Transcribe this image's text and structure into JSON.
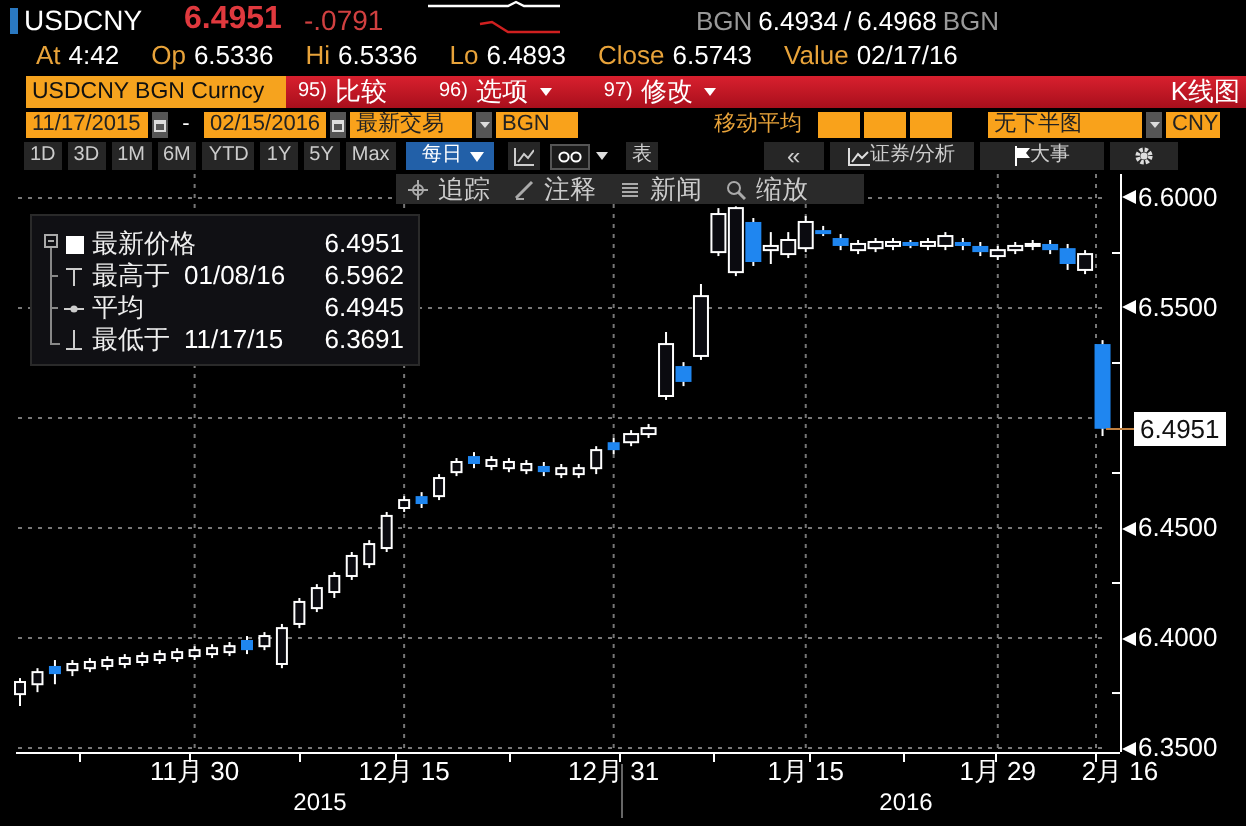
{
  "quote": {
    "ticker": "USDCNY",
    "last": "6.4951",
    "change": "-.0791",
    "bid_source": "BGN",
    "bid": "6.4934",
    "separator": "/",
    "ask": "6.4968",
    "ask_source": "BGN"
  },
  "stats": [
    {
      "label": "At",
      "value": "4:42"
    },
    {
      "label": "Op",
      "value": "6.5336"
    },
    {
      "label": "Hi",
      "value": "6.5336"
    },
    {
      "label": "Lo",
      "value": "6.4893"
    },
    {
      "label": "Close",
      "value": "6.5743"
    },
    {
      "label": "Value",
      "value": "02/17/16"
    }
  ],
  "function_bar": {
    "security": "USDCNY BGN Curncy",
    "menus": [
      {
        "number": "95)",
        "label": "比较",
        "dropdown": false
      },
      {
        "number": "96)",
        "label": "选项",
        "dropdown": true
      },
      {
        "number": "97)",
        "label": "修改",
        "dropdown": true
      }
    ],
    "chart_type": "K线图"
  },
  "settings_bar": {
    "start_date": "11/17/2015",
    "separator": "-",
    "end_date": "02/15/2016",
    "price_type": "最新交易",
    "source": "BGN",
    "moving_average_label": "移动平均",
    "lower_chart": "无下半图",
    "currency": "CNY"
  },
  "period_bar": {
    "ranges": [
      "1D",
      "3D",
      "1M",
      "6M",
      "YTD",
      "1Y",
      "5Y",
      "Max"
    ],
    "frequency": "每日",
    "table": "表",
    "back": "«",
    "analysis": "证券/分析",
    "events": "大事"
  },
  "chart_toolbar": [
    {
      "kind": "crosshair",
      "label": "追踪"
    },
    {
      "kind": "pen",
      "label": "注释"
    },
    {
      "kind": "news",
      "label": "新闻"
    },
    {
      "kind": "zoom",
      "label": "缩放"
    }
  ],
  "legend": [
    {
      "kind": "last",
      "label": "最新价格",
      "value": "6.4951"
    },
    {
      "kind": "high",
      "label": "最高于",
      "date": "01/08/16",
      "value": "6.5962"
    },
    {
      "kind": "average",
      "label": "平均",
      "value": "6.4945"
    },
    {
      "kind": "low",
      "label": "最低于",
      "date": "11/17/15",
      "value": "6.3691"
    }
  ],
  "chart": {
    "chart_data": {
      "type": "candlestick",
      "grid": true,
      "ylim": [
        6.3482,
        6.6109
      ],
      "categories": [
        null,
        null,
        null,
        null,
        null,
        null,
        null,
        null,
        null,
        null,
        "11月 30",
        null,
        null,
        null,
        null,
        null,
        null,
        null,
        null,
        null,
        null,
        null,
        "12月 15",
        null,
        null,
        null,
        null,
        null,
        null,
        null,
        null,
        null,
        null,
        null,
        "12月 31",
        null,
        null,
        null,
        null,
        null,
        null,
        null,
        null,
        null,
        null,
        "1月 15",
        null,
        null,
        null,
        null,
        null,
        null,
        null,
        null,
        null,
        null,
        "1月 29",
        null,
        null,
        null,
        null,
        null,
        null,
        "2月 16"
      ],
      "ohlc": [
        [
          6.3745,
          6.3818,
          6.3691,
          6.38
        ],
        [
          6.379,
          6.3863,
          6.3754,
          6.3845
        ],
        [
          6.3873,
          6.39,
          6.379,
          6.3836
        ],
        [
          6.3854,
          6.39,
          6.3827,
          6.3882
        ],
        [
          6.3863,
          6.3909,
          6.3845,
          6.3891
        ],
        [
          6.3873,
          6.3918,
          6.3854,
          6.39
        ],
        [
          6.3882,
          6.3927,
          6.3863,
          6.3909
        ],
        [
          6.3891,
          6.3936,
          6.3873,
          6.3918
        ],
        [
          6.39,
          6.3945,
          6.3882,
          6.3927
        ],
        [
          6.3909,
          6.3954,
          6.3891,
          6.3936
        ],
        [
          6.3918,
          6.3963,
          6.39,
          6.3945
        ],
        [
          6.3927,
          6.3972,
          6.3909,
          6.3954
        ],
        [
          6.3936,
          6.3982,
          6.3918,
          6.3963
        ],
        [
          6.3991,
          6.4009,
          6.3927,
          6.3945
        ],
        [
          6.3963,
          6.4027,
          6.3945,
          6.4009
        ],
        [
          6.3882,
          6.4064,
          6.3863,
          6.4045
        ],
        [
          6.4064,
          6.4182,
          6.4045,
          6.4164
        ],
        [
          6.4136,
          6.4245,
          6.4118,
          6.4227
        ],
        [
          6.4209,
          6.43,
          6.4182,
          6.4282
        ],
        [
          6.4282,
          6.4391,
          6.4264,
          6.4373
        ],
        [
          6.4336,
          6.4445,
          6.4318,
          6.4427
        ],
        [
          6.4409,
          6.4573,
          6.4391,
          6.4555
        ],
        [
          6.4591,
          6.4645,
          6.4573,
          6.4627
        ],
        [
          6.4645,
          6.4663,
          6.4591,
          6.4609
        ],
        [
          6.4645,
          6.4745,
          6.4627,
          6.4727
        ],
        [
          6.4754,
          6.4818,
          6.4736,
          6.48
        ],
        [
          6.4827,
          6.4845,
          6.4772,
          6.4791
        ],
        [
          6.4782,
          6.4827,
          6.4763,
          6.4809
        ],
        [
          6.4772,
          6.4818,
          6.4754,
          6.48
        ],
        [
          6.4763,
          6.4809,
          6.4745,
          6.4791
        ],
        [
          6.4782,
          6.48,
          6.4736,
          6.4754
        ],
        [
          6.4745,
          6.4791,
          6.4727,
          6.4772
        ],
        [
          6.4745,
          6.4791,
          6.4727,
          6.4772
        ],
        [
          6.4772,
          6.4872,
          6.4745,
          6.4854
        ],
        [
          6.489,
          6.4909,
          6.4836,
          6.4854
        ],
        [
          6.489,
          6.4945,
          6.4872,
          6.4927
        ],
        [
          6.4927,
          6.4973,
          6.4909,
          6.4954
        ],
        [
          6.51,
          6.5391,
          6.5082,
          6.5336
        ],
        [
          6.5236,
          6.5254,
          6.5145,
          6.5164
        ],
        [
          6.5282,
          6.5609,
          6.5264,
          6.5554
        ],
        [
          6.5754,
          6.5954,
          6.5736,
          6.5927
        ],
        [
          6.5663,
          6.5962,
          6.5645,
          6.5954
        ],
        [
          6.5891,
          6.5909,
          6.5691,
          6.5709
        ],
        [
          6.5763,
          6.5845,
          6.57,
          6.5782
        ],
        [
          6.5745,
          6.5845,
          6.5727,
          6.5809
        ],
        [
          6.5772,
          6.5918,
          6.5754,
          6.5891
        ],
        [
          6.5854,
          6.5873,
          6.5827,
          6.5845
        ],
        [
          6.5818,
          6.5836,
          6.5763,
          6.5782
        ],
        [
          6.5763,
          6.5809,
          6.5745,
          6.5791
        ],
        [
          6.5772,
          6.5818,
          6.5754,
          6.58
        ],
        [
          6.5782,
          6.5818,
          6.5763,
          6.58
        ],
        [
          6.58,
          6.5809,
          6.5772,
          6.5791
        ],
        [
          6.5782,
          6.5818,
          6.5763,
          6.58
        ],
        [
          6.5782,
          6.5845,
          6.5763,
          6.5827
        ],
        [
          6.58,
          6.5818,
          6.5763,
          6.5782
        ],
        [
          6.5782,
          6.58,
          6.5736,
          6.5754
        ],
        [
          6.5736,
          6.5782,
          6.5718,
          6.5763
        ],
        [
          6.5763,
          6.58,
          6.5745,
          6.5782
        ],
        [
          6.5782,
          6.5809,
          6.5763,
          6.5791
        ],
        [
          6.5791,
          6.5809,
          6.5745,
          6.5763
        ],
        [
          6.5772,
          6.5791,
          6.5673,
          6.57
        ],
        [
          6.5673,
          6.5763,
          6.5654,
          6.5745
        ],
        [
          6.5336,
          6.5354,
          6.4918,
          6.4951
        ],
        null
      ],
      "yticks": [
        {
          "value": 6.6,
          "label": "6.6000"
        },
        {
          "value": 6.55,
          "label": "6.5500"
        },
        {
          "value": 6.45,
          "label": "6.4500"
        },
        {
          "value": 6.4,
          "label": "6.4000"
        },
        {
          "value": 6.35,
          "label": "6.3500"
        }
      ]
    },
    "last_price": "6.4951"
  },
  "x_axis": {
    "years": [
      "2015",
      "2016"
    ]
  }
}
